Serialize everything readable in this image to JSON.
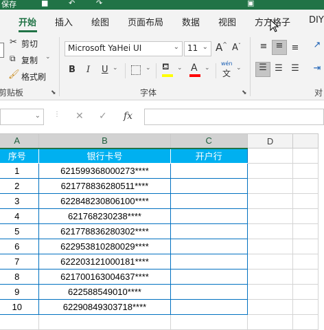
{
  "app": {
    "accent": "#217346",
    "header_fill": "#00b0f0",
    "cell_border": "#0070c0"
  },
  "quick_access": [
    "保存",
    "撤销",
    "重做",
    "绘制边框"
  ],
  "tabs": [
    {
      "label": "开始",
      "active": true
    },
    {
      "label": "插入"
    },
    {
      "label": "绘图"
    },
    {
      "label": "页面布局"
    },
    {
      "label": "数据"
    },
    {
      "label": "视图"
    },
    {
      "label": "方方格子"
    },
    {
      "label": "DIY"
    }
  ],
  "clipboard": {
    "cut": "剪切",
    "copy": "复制",
    "format_painter": "格式刷",
    "group_label": "剪贴板"
  },
  "font": {
    "name": "Microsoft YaHei UI",
    "size": "11",
    "bold": "B",
    "italic": "I",
    "underline": "U",
    "grow": "A",
    "shrink": "A",
    "color_letter": "A",
    "wen": "wén",
    "wen_char": "文",
    "group_label": "字体"
  },
  "alignment_group_label": "对",
  "formula_bar": {
    "cancel": "✕",
    "enter": "✓",
    "fx": "fx",
    "value": ""
  },
  "sheet": {
    "columns": [
      "A",
      "B",
      "C",
      "D"
    ],
    "headers": [
      "序号",
      "银行卡号",
      "开户行"
    ],
    "rows": [
      {
        "no": "1",
        "card": "621599368000273****"
      },
      {
        "no": "2",
        "card": "621778836280511****"
      },
      {
        "no": "3",
        "card": "622848230806100****"
      },
      {
        "no": "4",
        "card": "621768230238****"
      },
      {
        "no": "5",
        "card": "621778836280302****"
      },
      {
        "no": "6",
        "card": "622953810280029****"
      },
      {
        "no": "7",
        "card": "622203121000181****"
      },
      {
        "no": "8",
        "card": "621700163004637****"
      },
      {
        "no": "9",
        "card": "622588549010****"
      },
      {
        "no": "10",
        "card": "62290849303718****"
      }
    ]
  }
}
